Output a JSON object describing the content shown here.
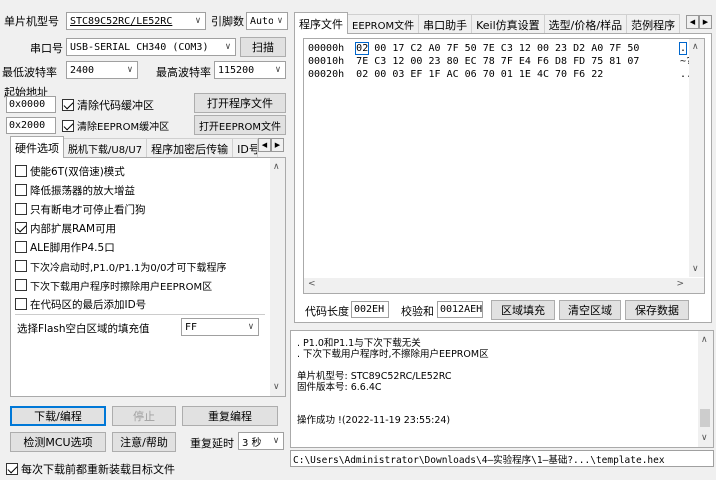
{
  "left": {
    "mcu_label": "单片机型号",
    "mcu_value": "STC89C52RC/LE52RC",
    "pins_label": "引脚数",
    "pins_value": "Auto",
    "port_label": "串口号",
    "port_value": "USB-SERIAL CH340 (COM3)",
    "scan_button": "扫描",
    "min_baud_label": "最低波特率",
    "min_baud_value": "2400",
    "max_baud_label": "最高波特率",
    "max_baud_value": "115200",
    "start_addr_label": "起始地址",
    "addr1_value": "0x0000",
    "clear_code_label": "清除代码缓冲区",
    "open_program_button": "打开程序文件",
    "addr2_value": "0x2000",
    "clear_eeprom_label": "清除EEPROM缓冲区",
    "open_eeprom_button": "打开EEPROM文件",
    "tabs": [
      "硬件选项",
      "脱机下载/U8/U7",
      "程序加密后传输",
      "ID号"
    ],
    "options": [
      {
        "label": "使能6T(双倍速)模式",
        "checked": false
      },
      {
        "label": "降低振荡器的放大增益",
        "checked": false
      },
      {
        "label": "只有断电才可停止看门狗",
        "checked": false
      },
      {
        "label": "内部扩展RAM可用",
        "checked": true
      },
      {
        "label": "ALE脚用作P4.5口",
        "checked": false
      },
      {
        "label": "下次冷启动时,P1.0/P1.1为0/0才可下载程序",
        "checked": false
      },
      {
        "label": "下次下载用户程序时擦除用户EEPROM区",
        "checked": false
      },
      {
        "label": "在代码区的最后添加ID号",
        "checked": false
      }
    ],
    "fill_label": "选择Flash空白区域的填充值",
    "fill_value": "FF",
    "download_button": "下载/编程",
    "stop_button": "停止",
    "reprogram_button": "重复编程",
    "detect_button": "检测MCU选项",
    "help_button": "注意/帮助",
    "delay_label": "重复延时",
    "delay_value": "3 秒",
    "reload_label": "每次下载前都重新装载目标文件"
  },
  "right": {
    "tabs": [
      "程序文件",
      "EEPROM文件",
      "串口助手",
      "Keil仿真设置",
      "选型/价格/样品",
      "范例程序"
    ],
    "hex_lines": [
      {
        "addr": "00000h",
        "bytes": [
          "02",
          "00",
          "17",
          "C2",
          "A0",
          "7F",
          "50",
          "7E",
          "C3",
          "12",
          "00",
          "23",
          "D2",
          "A0",
          "7F",
          "50"
        ],
        "ascii": "."
      },
      {
        "addr": "00010h",
        "bytes": [
          "7E",
          "C3",
          "12",
          "00",
          "23",
          "80",
          "EC",
          "78",
          "7F",
          "E4",
          "F6",
          "D8",
          "FD",
          "75",
          "81",
          "07"
        ],
        "ascii": "~?"
      },
      {
        "addr": "00020h",
        "bytes": [
          "02",
          "00",
          "03",
          "EF",
          "1F",
          "AC",
          "06",
          "70",
          "01",
          "1E",
          "4C",
          "70",
          "F6",
          "22"
        ],
        "ascii": ".."
      }
    ],
    "code_len_label": "代码长度",
    "code_len_value": "002EH",
    "checksum_label": "校验和",
    "checksum_value": "0012AEH",
    "fill_area_button": "区域填充",
    "clear_area_button": "清空区域",
    "save_data_button": "保存数据",
    "log_lines": [
      ". P1.0和P1.1与下次下载无关",
      ". 下次下载用户程序时,不擦除用户EEPROM区",
      "",
      "单片机型号: STC89C52RC/LE52RC",
      "固件版本号: 6.6.4C",
      "",
      "",
      "操作成功 !(2022-11-19 23:55:24)"
    ],
    "file_path": "C:\\Users\\Administrator\\Downloads\\4—实验程序\\1—基础?...\\template.hex"
  },
  "icons": {
    "dropdown": "▾",
    "scroll_up": "▲",
    "scroll_down": "▼",
    "scroll_left": "◀",
    "scroll_right": "▶"
  }
}
